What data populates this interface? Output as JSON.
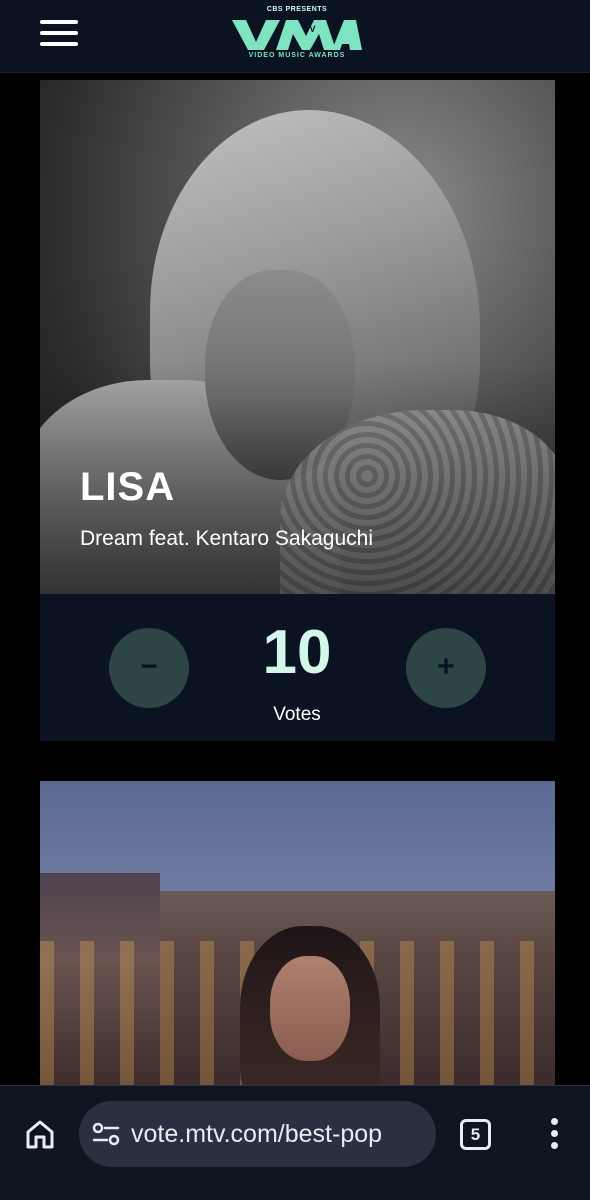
{
  "header": {
    "logo_presenter": "CBS PRESENTS",
    "logo_mark": "VMA",
    "logo_tv": "TV",
    "logo_subtitle": "VIDEO MUSIC AWARDS",
    "menu_icon": "hamburger-menu-icon"
  },
  "nominees": [
    {
      "artist": "LISA",
      "song": "Dream feat. Kentaro Sakaguchi",
      "votes": "10",
      "votes_label": "Votes",
      "decrement_label": "−",
      "increment_label": "+"
    },
    {
      "artist": "",
      "song": ""
    }
  ],
  "browser": {
    "url": "vote.mtv.com/best-pop",
    "tab_count": "5",
    "icons": [
      "home-icon",
      "site-settings-icon",
      "tab-switcher-icon",
      "more-options-icon"
    ]
  },
  "colors": {
    "header_bg": "#0b1322",
    "accent": "#7ee3c1",
    "vote_button": "#2e4545",
    "vote_count": "#d5f7e9",
    "browser_bg": "#0e1420",
    "url_pill": "#283042"
  }
}
